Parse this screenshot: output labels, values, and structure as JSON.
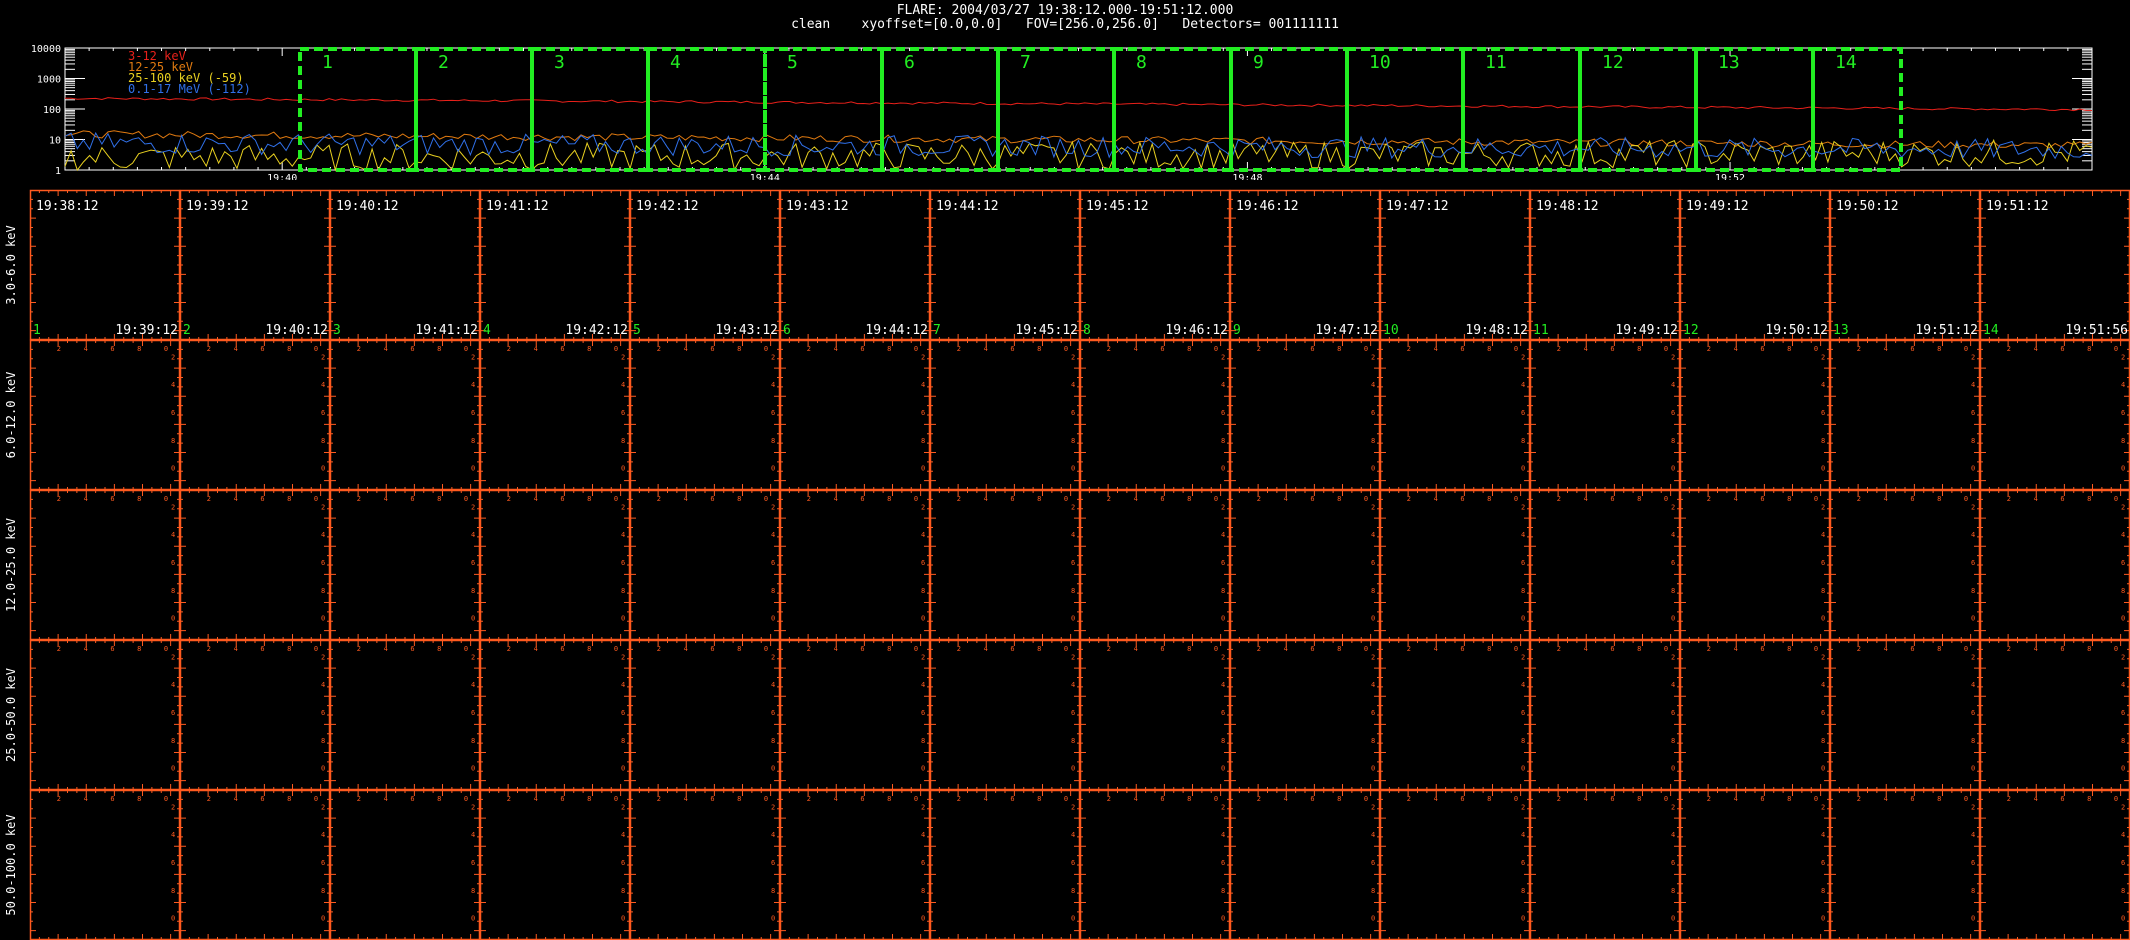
{
  "header": {
    "line1": "FLARE: 2004/03/27 19:38:12.000-19:51:12.000",
    "line2": "clean    xyoffset=[0.0,0.0]   FOV=[256.0,256.0]   Detectors= 001111111"
  },
  "colors": {
    "background": "#000000",
    "grid": "#ff5a1f",
    "interval_box": "#22ee22",
    "band_3_12": "#e8201a",
    "band_12_25": "#e07a10",
    "band_25_100": "#e8d020",
    "band_01_17": "#3070e8"
  },
  "chart_data": [
    {
      "type": "line",
      "yscale": "log",
      "ylim": [
        1,
        10000
      ],
      "ytick_labels": [
        "10000",
        "1000",
        "100",
        "10",
        "1"
      ],
      "ytick_values": [
        10000,
        1000,
        100,
        10,
        1
      ],
      "xtick_labels": [
        "19:40",
        "19:44",
        "19:48",
        "19:52"
      ],
      "xtick_minutes": [
        1.8,
        5.8,
        9.8,
        13.8
      ],
      "xlim_minutes": [
        0,
        16.8
      ],
      "series": [
        {
          "name": "3-12 keV",
          "color": "#e8201a",
          "approx_level": 150
        },
        {
          "name": "12-25 keV",
          "color": "#e07a10",
          "approx_level": 10
        },
        {
          "name": "25-100 keV (-59)",
          "color": "#e8d020",
          "approx_level": 3
        },
        {
          "name": "0.1-17 MeV (-112)",
          "color": "#3070e8",
          "approx_level": 6
        }
      ],
      "intervals": [
        "1",
        "2",
        "3",
        "4",
        "5",
        "6",
        "7",
        "8",
        "9",
        "10",
        "11",
        "12",
        "13",
        "14"
      ]
    },
    {
      "type": "table",
      "row_labels": [
        "3.0-6.0 keV",
        "6.0-12.0 keV",
        "12.0-25.0 keV",
        "25.0-50.0 keV",
        "50.0-100.0 keV"
      ],
      "start_times": [
        "19:38:12",
        "19:39:12",
        "19:40:12",
        "19:41:12",
        "19:42:12",
        "19:43:12",
        "19:44:12",
        "19:45:12",
        "19:46:12",
        "19:47:12",
        "19:48:12",
        "19:49:12",
        "19:50:12",
        "19:51:12"
      ],
      "end_times": [
        "19:39:12",
        "19:40:12",
        "19:41:12",
        "19:42:12",
        "19:43:12",
        "19:44:12",
        "19:45:12",
        "19:46:12",
        "19:47:12",
        "19:48:12",
        "19:49:12",
        "19:50:12",
        "19:51:12",
        "19:51:56"
      ],
      "numbers": [
        "1",
        "2",
        "3",
        "4",
        "5",
        "6",
        "7",
        "8",
        "9",
        "10",
        "11",
        "12",
        "13",
        "14"
      ]
    }
  ]
}
